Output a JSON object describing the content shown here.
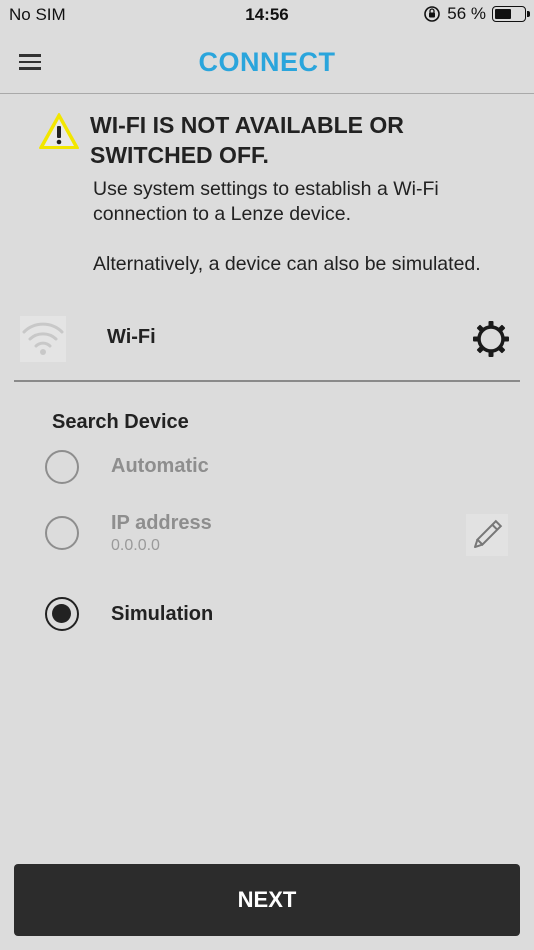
{
  "status_bar": {
    "carrier": "No SIM",
    "time": "14:56",
    "battery_percent_text": "56 %",
    "battery_level": 0.56,
    "icons": [
      "orientation-lock-icon",
      "battery-icon"
    ]
  },
  "header": {
    "title": "CONNECT",
    "title_color": "#2aa5dc",
    "menu_icon": "hamburger-menu-icon"
  },
  "warning": {
    "icon": "warning-triangle-icon",
    "title": "WI-FI IS NOT AVAILABLE OR SWITCHED OFF.",
    "text_1": "Use system settings to establish a Wi-Fi connection to a Lenze device.",
    "text_2": "Alternatively, a device can also be simulated."
  },
  "wifi": {
    "label": "Wi-Fi",
    "icon": "wifi-icon",
    "settings_icon": "gear-icon"
  },
  "search": {
    "title": "Search Device",
    "options": [
      {
        "label": "Automatic",
        "selected": false,
        "enabled": false
      },
      {
        "label": "IP address",
        "value": "0.0.0.0",
        "selected": false,
        "enabled": false
      },
      {
        "label": "Simulation",
        "selected": true,
        "enabled": true
      }
    ],
    "edit_icon": "pencil-icon"
  },
  "footer": {
    "next_label": "NEXT"
  },
  "colors": {
    "background": "#dcdcdc",
    "accent": "#2aa5dc",
    "button": "#2c2c2c",
    "warning_yellow": "#f2e600"
  }
}
